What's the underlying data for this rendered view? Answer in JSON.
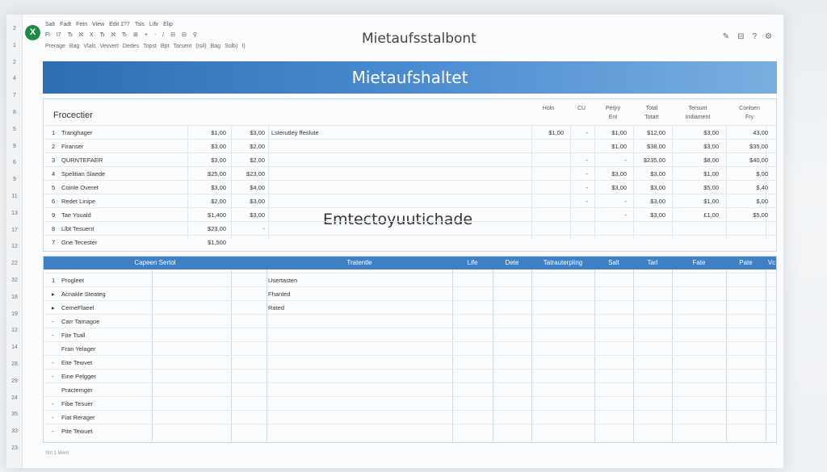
{
  "window": {
    "title": "Mietaufsstalbont",
    "app_icon": "X",
    "menu": [
      "Salt",
      "Fadt",
      "Fetn",
      "View",
      "Edit 1?7",
      "Tsis",
      "Lifir",
      "Elip"
    ],
    "toolbar": [
      "Fl",
      "I7",
      "Ђ",
      "ℵ",
      "X",
      "Ђ",
      "ℵ",
      "Ђ",
      "⊞",
      "+",
      "⋅",
      "/",
      "⊟",
      "⊟",
      "⚲"
    ],
    "ribbon_tabs": [
      "Prerage",
      "Bag",
      "Vlals",
      "Vevvert",
      "Dedes",
      "Topst",
      "Bpt",
      "Tarsent",
      "(Isil)",
      "Bag",
      "Solb)",
      "I)"
    ],
    "right_icons": [
      "pencil-icon",
      "folder-icon",
      "help-icon",
      "settings-icon"
    ],
    "right_glyphs": [
      "✎",
      "⊟",
      "?",
      "⚙"
    ]
  },
  "row_numbers": [
    "2",
    "1",
    "2",
    "4",
    "7",
    "8",
    "5",
    "9",
    "6",
    "9",
    "11",
    "13",
    "17",
    "12",
    "22",
    "32",
    "18",
    "19",
    "12",
    "14",
    "28",
    "29",
    "24",
    "35",
    "33",
    "23"
  ],
  "banner": {
    "title": "Mietaufshaltet"
  },
  "summary": {
    "title": "Frocectier",
    "headers": [
      "Holn",
      "CU",
      "Perjry\nEnt",
      "Total\nTotart",
      "Tersunt\nIndiament",
      "Conlsen\nFry"
    ],
    "note": "Lsterutley ffeslute",
    "overlay_text": "Emtectoyuutichade",
    "rows": [
      {
        "num": "1",
        "name": "Tranghager",
        "a": "$1,00",
        "b": "$3,00",
        "vals": [
          "$1,00",
          "-",
          "$1,00",
          "$12,00",
          "$3,00",
          "43,00"
        ]
      },
      {
        "num": "2",
        "name": "Firanser",
        "a": "$3,00",
        "b": "$2,00",
        "vals": [
          "",
          "",
          "$1,00",
          "$38,00",
          "$3,00",
          "$35,00"
        ]
      },
      {
        "num": "3",
        "name": "QURNTEFAER",
        "a": "$3,00",
        "b": "$2,00",
        "vals": [
          "",
          "-",
          "-",
          "$235,00",
          "$8,00",
          "$40,00"
        ]
      },
      {
        "num": "4",
        "name": "Spelitian Slaede",
        "a": "$25,00",
        "b": "$23,00",
        "vals": [
          "",
          "-",
          "$3,00",
          "$3,00",
          "$1,00",
          "$,00"
        ]
      },
      {
        "num": "5",
        "name": "Coinle Overet",
        "a": "$3,00",
        "b": "$4,00",
        "vals": [
          "",
          "-",
          "$3,00",
          "$3,00",
          "$5,00",
          "$,40"
        ]
      },
      {
        "num": "6",
        "name": "Redet Linipe",
        "a": "$2,00",
        "b": "$3,00",
        "vals": [
          "",
          "-",
          "-",
          "$3,00",
          "$1,00",
          "$,00"
        ]
      },
      {
        "num": "9",
        "name": "Tae Youald",
        "a": "$1,400",
        "b": "$3,00",
        "vals": [
          "",
          "",
          "-",
          "$3,00",
          "£1,00",
          "$5,00"
        ]
      },
      {
        "num": "8",
        "name": "Llbt Tesuent",
        "a": "$23,00",
        "b": "-",
        "vals": [
          "",
          "",
          "",
          "",
          "",
          ""
        ]
      },
      {
        "num": "7",
        "name": "Gne Tecester",
        "a": "$1,500",
        "b": "",
        "vals": [
          "",
          "",
          "",
          "",
          "",
          ""
        ]
      }
    ]
  },
  "detail": {
    "headers": [
      "Capeen Sertol",
      "Tratentle",
      "Life",
      "Dete",
      "Tatrauterpling",
      "Salt",
      "Tarl",
      "Fate",
      "Pate",
      "Vc"
    ],
    "rows": [
      {
        "num": "1",
        "name": "Progleet",
        "note": "Usertasten"
      },
      {
        "num": "▸",
        "name": "Acnakle Steateg",
        "note": "Fhanted"
      },
      {
        "num": "▸",
        "name": "CemeFlaeel",
        "note": "Rated"
      },
      {
        "num": "-",
        "name": "Carr Tamagoe",
        "note": ""
      },
      {
        "num": "-",
        "name": "Fite Tsall",
        "note": ""
      },
      {
        "num": "",
        "name": "Fran Yelager",
        "note": ""
      },
      {
        "num": "-",
        "name": "Eite Tewvet",
        "note": ""
      },
      {
        "num": "-",
        "name": "Eine Pelgger",
        "note": ""
      },
      {
        "num": "",
        "name": "Practemger",
        "note": ""
      },
      {
        "num": "-",
        "name": "Fibe Tesuer",
        "note": ""
      },
      {
        "num": "-",
        "name": "Fiat Rerager",
        "note": ""
      },
      {
        "num": "-",
        "name": "Pite Tewuet",
        "note": ""
      }
    ]
  },
  "footer": "Sht 1 Ment",
  "colors": {
    "banner_start": "#2f6db2",
    "banner_end": "#7aaee0",
    "header_band": "#3f7fc4",
    "app_green": "#1e8b45"
  }
}
